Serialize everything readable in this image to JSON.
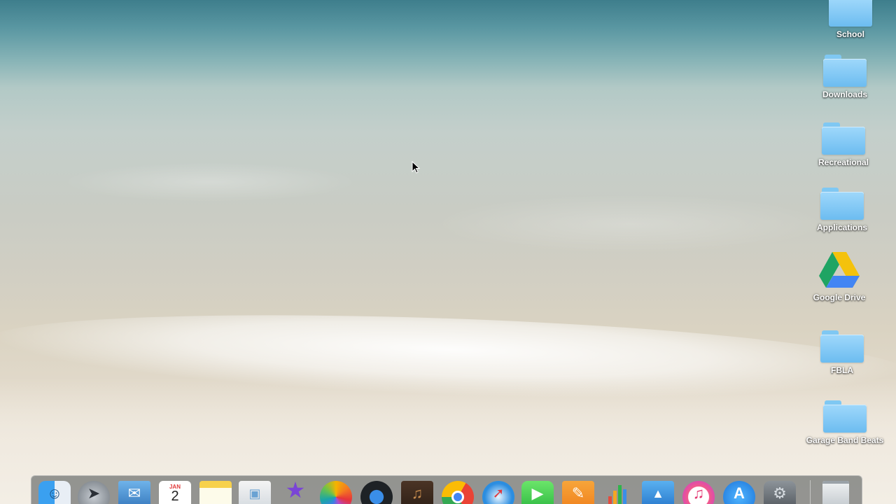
{
  "desktop": {
    "wallpaper": "beach",
    "icons": [
      {
        "label": "School",
        "icon": "folder-icon"
      },
      {
        "label": "Downloads",
        "icon": "folder-icon"
      },
      {
        "label": "Recreational",
        "icon": "folder-icon"
      },
      {
        "label": "Applications",
        "icon": "folder-icon"
      },
      {
        "label": "Google Drive",
        "icon": "google-drive-icon"
      },
      {
        "label": "FBLA",
        "icon": "folder-icon"
      },
      {
        "label": "Garage Band Beats",
        "icon": "folder-icon"
      }
    ]
  },
  "dock": {
    "calendar": {
      "month": "JAN",
      "day": "2"
    },
    "apps": [
      "finder-icon",
      "launchpad-icon",
      "mail-icon",
      "calendar-icon",
      "notes-icon",
      "preview-icon",
      "imovie-icon",
      "photos-icon",
      "quicktime-icon",
      "garageband-icon",
      "chrome-icon",
      "safari-icon",
      "facetime-icon",
      "pages-icon",
      "numbers-icon",
      "keynote-icon",
      "itunes-icon",
      "app-store-icon",
      "system-preferences-icon",
      "trash-icon"
    ]
  },
  "colors": {
    "folder": "#7fc8f3",
    "label_text": "#ffffff",
    "dock_background": "#464a4c"
  }
}
